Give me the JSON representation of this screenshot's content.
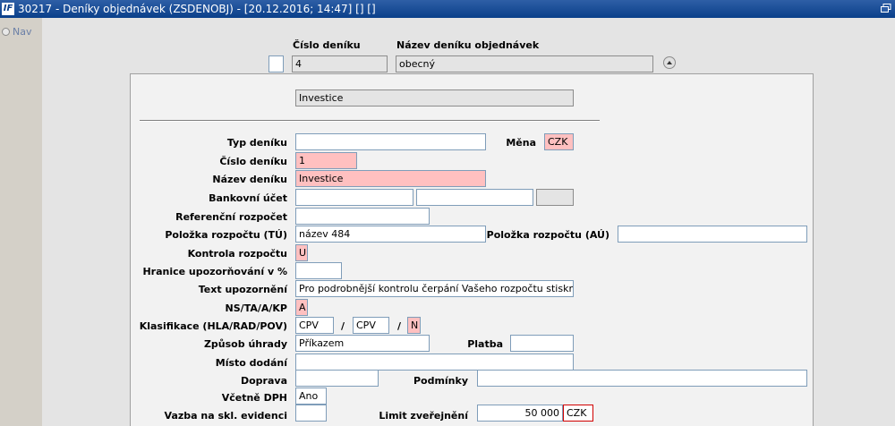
{
  "window": {
    "title": "30217 - Deníky objednávek (ZSDENOBJ) - [20.12.2016; 14:47]  [] []",
    "logo_text": "IF"
  },
  "sidebar": {
    "nav_label": "Nav"
  },
  "header": {
    "cislo_label": "Číslo deníku",
    "nazev_label": "Název deníku objednávek",
    "cislo_value": "4",
    "nazev_value": "obecný"
  },
  "detail": {
    "top_value": "Investice",
    "fields": {
      "typ_label": "Typ deníku",
      "typ_value": "",
      "mena_label": "Měna",
      "mena_value": "CZK",
      "cislo_label": "Číslo deníku",
      "cislo_value": "1",
      "nazev_label": "Název deníku",
      "nazev_value": "Investice",
      "bank_label": "Bankovní účet",
      "bank_value1": "",
      "bank_value2": "",
      "bank_value3": "",
      "ref_label": "Referenční rozpočet",
      "ref_value": "",
      "pol_tu_label": "Položka rozpočtu (TÚ)",
      "pol_tu_value": "název 484",
      "pol_au_label": "Položka rozpočtu (AÚ)",
      "pol_au_value": "",
      "kontrola_label": "Kontrola rozpočtu",
      "kontrola_value": "U",
      "hranice_label": "Hranice upozorňování v %",
      "hranice_value": "",
      "text_label": "Text upozornění",
      "text_value": "Pro podrobnější kontrolu čerpání Vašeho rozpočtu stiskněte tlač",
      "ns_label": "NS/TA/A/KP",
      "ns_value": "A",
      "klas_label": "Klasifikace (HLA/RAD/POV)",
      "klas_value1": "CPV",
      "klas_value2": "CPV",
      "klas_value3": "N",
      "slash": "/",
      "zpusob_label": "Způsob úhrady",
      "zpusob_value": "Příkazem",
      "platba_label": "Platba",
      "platba_value": "",
      "misto_label": "Místo dodání",
      "misto_value": "",
      "doprava_label": "Doprava",
      "doprava_value": "",
      "podminky_label": "Podmínky",
      "podminky_value": "",
      "dph_label": "Včetně DPH",
      "dph_value": "Ano",
      "vazba_label": "Vazba na skl. evidenci",
      "vazba_value": "",
      "limit_label": "Limit zveřejnění",
      "limit_value": "50 000",
      "limit_currency": "CZK"
    }
  }
}
